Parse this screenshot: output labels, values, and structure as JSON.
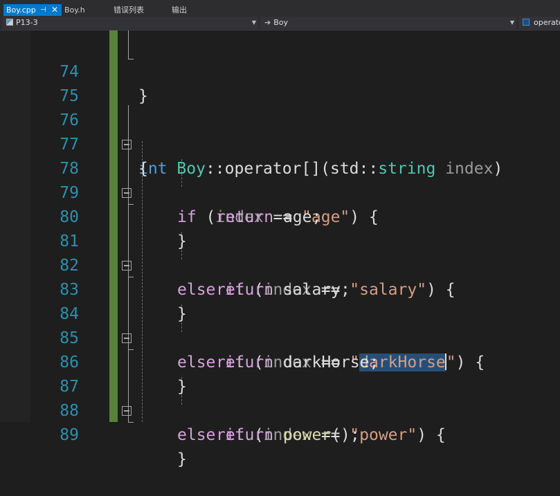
{
  "tabs": [
    {
      "label": "Boy.cpp",
      "pin": "⊣",
      "close": "✕",
      "active": true
    },
    {
      "label": "Boy.h",
      "active": false
    },
    {
      "label": "错误列表",
      "active": false
    },
    {
      "label": "输出",
      "active": false
    }
  ],
  "navbar": {
    "project": "P13-3",
    "scope": "Boy",
    "member": "operator"
  },
  "lines": [
    {
      "num": "74"
    },
    {
      "num": "75"
    },
    {
      "num": "76"
    },
    {
      "num": "77"
    },
    {
      "num": "78"
    },
    {
      "num": "79"
    },
    {
      "num": "80"
    },
    {
      "num": "81"
    },
    {
      "num": "82"
    },
    {
      "num": "83"
    },
    {
      "num": "84"
    },
    {
      "num": "85"
    },
    {
      "num": "86"
    },
    {
      "num": "87"
    },
    {
      "num": "88"
    },
    {
      "num": "89"
    }
  ],
  "code": {
    "l74": "}",
    "l76": {
      "kw": "int",
      "cls": "Boy",
      "sep": "::",
      "op": "operator[](",
      "ns": "std",
      "sep2": "::",
      "type": "string",
      "param": "index",
      "close": ")"
    },
    "l77": "{",
    "l78": {
      "kw": "if",
      "open": " (",
      "param": "index",
      "eq": " == ",
      "str": "\"age\"",
      "close": ") {"
    },
    "l79": {
      "kw": "return",
      "rest": " age;"
    },
    "l80": "}",
    "l81": {
      "kw": "else if",
      "open": " (",
      "param": "index",
      "eq": " == ",
      "str": "\"salary\"",
      "close": ") {"
    },
    "l82": {
      "kw": "return",
      "rest": " salary;"
    },
    "l83": "}",
    "l84": {
      "kw": "else if",
      "open": " (",
      "param": "index",
      "eq": " == ",
      "q1": "\"",
      "sel": "darkHorse",
      "q2": "\"",
      "close": ") {"
    },
    "l85": {
      "kw": "return",
      "rest": " darkHorse;"
    },
    "l86": "}",
    "l87": {
      "kw": "else if",
      "open": " (",
      "param": "index",
      "eq": " == ",
      "str": "\"power\"",
      "close": ") {"
    },
    "l88": {
      "kw": "return",
      "fn": " power",
      "rest": "();"
    },
    "l89": "}"
  },
  "colors": {
    "accent": "#007acc",
    "line_number": "#2b91af",
    "keyword": "#569cd6",
    "control_keyword": "#d8a0df",
    "type": "#4ec9b0",
    "string": "#d69d85",
    "change_bar": "#57823b"
  }
}
